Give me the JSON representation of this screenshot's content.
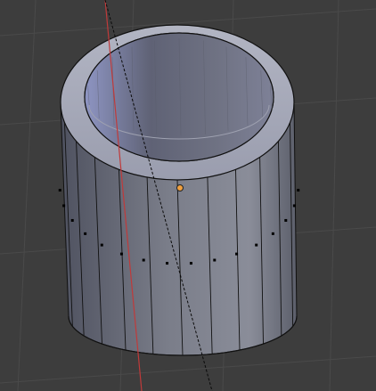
{
  "viewport": {
    "name": "3d-viewport",
    "background": "#3d3d3d",
    "grid_color": "#4a4a4a",
    "axis_color": "#c03a3a"
  },
  "mesh": {
    "object": "hollow-cylinder",
    "side_face_count": 24,
    "outer_color": "#6c6f7a",
    "rim_color": "#a9acba",
    "inner_color": "#8d92ab",
    "edge_color": "#111111",
    "vertex_color": "#000000"
  },
  "origin_point": {
    "color": "#f0a040"
  }
}
